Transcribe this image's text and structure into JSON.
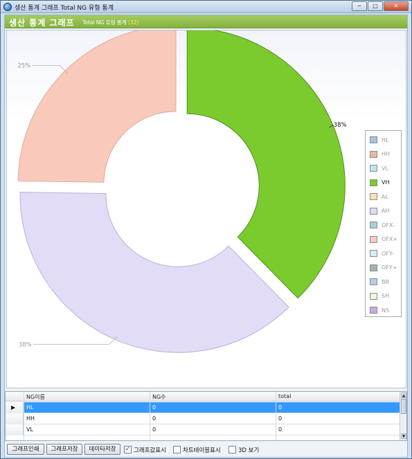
{
  "window": {
    "title": "생산 통계 그래프 Total NG 유형 통계",
    "minimize": "─",
    "maximize": "□",
    "close": "✕"
  },
  "header": {
    "title": "생산 통계 그래프",
    "subtitle": "Total NG 유형 통계",
    "count": "(32)"
  },
  "chart_data": {
    "type": "pie",
    "style": "exploded-donut",
    "title": "",
    "slices": [
      {
        "name": "VH",
        "value": 38,
        "label": "38%",
        "color": "#7ccb2e",
        "edge": "#4a8f1c"
      },
      {
        "name": "AH",
        "value": 38,
        "label": "38%",
        "color": "#e3dcf6",
        "edge": "#b9b0d6"
      },
      {
        "name": "OFX+",
        "value": 25,
        "label": "25%",
        "color": "#f9cabc",
        "edge": "#e0aa9a"
      }
    ],
    "legend": [
      {
        "name": "HL",
        "color": "#a8c4e4"
      },
      {
        "name": "HH",
        "color": "#eab79f"
      },
      {
        "name": "VL",
        "color": "#bfe6ea"
      },
      {
        "name": "VH",
        "color": "#7ccb2e"
      },
      {
        "name": "AL",
        "color": "#fde2b4"
      },
      {
        "name": "AH",
        "color": "#e3dcf6"
      },
      {
        "name": "OFX-",
        "color": "#a7d0d2"
      },
      {
        "name": "OFX+",
        "color": "#f9cabc"
      },
      {
        "name": "OFY-",
        "color": "#d5eef0"
      },
      {
        "name": "OFY+",
        "color": "#9fb3b5"
      },
      {
        "name": "BR",
        "color": "#b4cdf1"
      },
      {
        "name": "SH",
        "color": "#e8fbdc"
      },
      {
        "name": "NS",
        "color": "#caa9e6"
      }
    ],
    "legend_position": "right",
    "active_legend": "VH"
  },
  "grid": {
    "columns": [
      "NG이름",
      "NG수",
      "total"
    ],
    "rows": [
      {
        "name": "HL",
        "count": "0",
        "total": "0"
      },
      {
        "name": "HH",
        "count": "0",
        "total": "0"
      },
      {
        "name": "VL",
        "count": "0",
        "total": "0"
      }
    ],
    "selected_row": 0,
    "row_arrow": "▶"
  },
  "toolbar": {
    "print_label": "그래프인쇄",
    "save_graph_label": "그래프저장",
    "save_data_label": "데이타저장",
    "show_values_label": "그래프값표시",
    "show_values_checked": true,
    "show_table_label": "차트테이블표시",
    "show_table_checked": false,
    "view3d_label": "3D 보기",
    "view3d_checked": false,
    "check_mark": "✓"
  }
}
